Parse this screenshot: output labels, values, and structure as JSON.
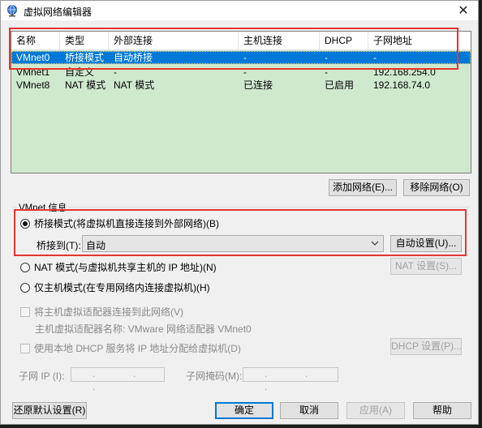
{
  "window": {
    "title": "虚拟网络编辑器",
    "close_glyph": "✕"
  },
  "table": {
    "columns": [
      "名称",
      "类型",
      "外部连接",
      "主机连接",
      "DHCP",
      "子网地址"
    ],
    "rows": [
      {
        "name": "VMnet0",
        "type": "桥接模式",
        "external": "自动桥接",
        "host": "-",
        "dhcp": "-",
        "subnet": "-",
        "selected": true
      },
      {
        "name": "VMnet1",
        "type": "自定义",
        "external": "-",
        "host": "-",
        "dhcp": "-",
        "subnet": "192.168.254.0",
        "selected": false
      },
      {
        "name": "VMnet8",
        "type": "NAT 模式",
        "external": "NAT 模式",
        "host": "已连接",
        "dhcp": "已启用",
        "subnet": "192.168.74.0",
        "selected": false
      }
    ]
  },
  "table_buttons": {
    "add": "添加网络(E)...",
    "remove": "移除网络(O)"
  },
  "vmnet_info": {
    "title": "VMnet 信息",
    "bridged_label": "桥接模式(将虚拟机直接连接到外部网络)(B)",
    "bridged_to_label": "桥接到(T):",
    "bridged_to_value": "自动",
    "auto_settings": "自动设置(U)...",
    "nat_label": "NAT 模式(与虚拟机共享主机的 IP 地址)(N)",
    "nat_settings": "NAT 设置(S)...",
    "hostonly_label": "仅主机模式(在专用网络内连接虚拟机)(H)",
    "connect_adapter_label": "将主机虚拟适配器连接到此网络(V)",
    "adapter_name_label": "主机虚拟适配器名称: VMware 网络适配器 VMnet0",
    "dhcp_label": "使用本地 DHCP 服务将 IP 地址分配给虚拟机(D)",
    "dhcp_settings": "DHCP 设置(P)...",
    "subnet_ip_label": "子网 IP (I):",
    "subnet_mask_label": "子网掩码(M):",
    "ip_dots": ". . ."
  },
  "footer": {
    "restore": "还原默认设置(R)",
    "ok": "确定",
    "cancel": "取消",
    "apply": "应用(A)",
    "help": "帮助"
  },
  "colors": {
    "table_bg": "#cfe9cf",
    "selection": "#0078d7",
    "highlight": "#e8342f"
  },
  "icons": {
    "app": "vmware-network-globe-icon",
    "close": "close-icon",
    "dropdown": "chevron-down-icon"
  }
}
